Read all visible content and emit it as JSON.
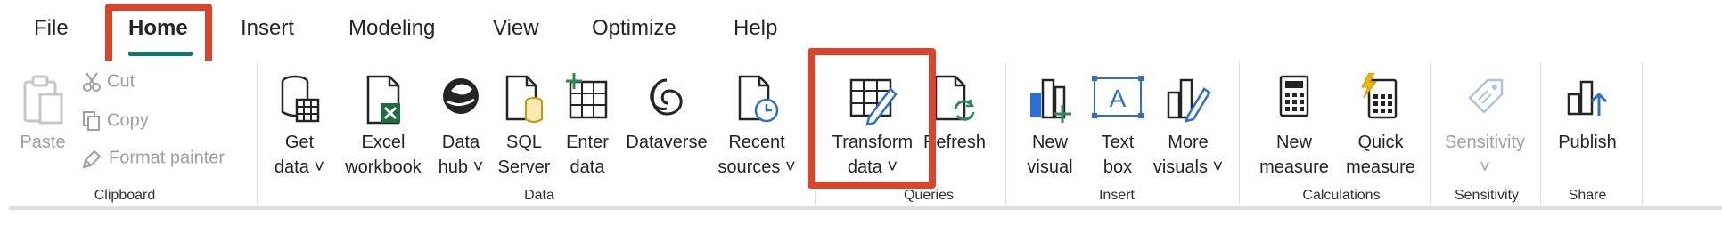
{
  "tabs": [
    {
      "label": "File"
    },
    {
      "label": "Home"
    },
    {
      "label": "Insert"
    },
    {
      "label": "Modeling"
    },
    {
      "label": "View"
    },
    {
      "label": "Optimize"
    },
    {
      "label": "Help"
    }
  ],
  "active_tab": "Home",
  "clipboard": {
    "paste": "Paste",
    "cut": "Cut",
    "copy": "Copy",
    "format_painter": "Format painter",
    "group": "Clipboard"
  },
  "data_group": {
    "get_data": [
      "Get",
      "data ˅"
    ],
    "excel": [
      "Excel",
      "workbook"
    ],
    "data_hub": [
      "Data",
      "hub ˅"
    ],
    "sql": [
      "SQL",
      "Server"
    ],
    "enter_data": [
      "Enter",
      "data"
    ],
    "dataverse": [
      "Dataverse"
    ],
    "recent": [
      "Recent",
      "sources ˅"
    ],
    "group": "Data"
  },
  "queries": {
    "transform": [
      "Transform",
      "data ˅"
    ],
    "refresh": [
      "Refresh"
    ],
    "group": "Queries"
  },
  "insert_group": {
    "new_visual": [
      "New",
      "visual"
    ],
    "text_box": [
      "Text",
      "box"
    ],
    "more_visuals": [
      "More",
      "visuals ˅"
    ],
    "group": "Insert"
  },
  "calculations": {
    "new_measure": [
      "New",
      "measure"
    ],
    "quick_measure": [
      "Quick",
      "measure"
    ],
    "group": "Calculations"
  },
  "sensitivity": {
    "label": "Sensitivity",
    "chevron": "˅",
    "group": "Sensitivity"
  },
  "share": {
    "publish": "Publish",
    "group": "Share"
  },
  "colors": {
    "highlight": "#d8452b",
    "accent": "#117865",
    "excel_green": "#1d6f42",
    "pbi_blue": "#2b6fd4"
  }
}
